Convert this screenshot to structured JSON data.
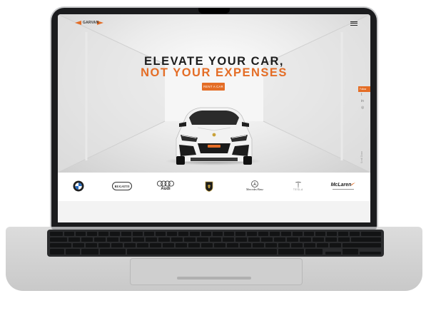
{
  "header": {
    "logo_text": "GARVAN",
    "menu_icon": "hamburger-menu-icon"
  },
  "hero": {
    "headline_line1": "ELEVATE YOUR CAR,",
    "headline_line2": "NOT YOUR EXPENSES",
    "cta_label": "RENT A CAR",
    "scroll_label": "Scroll Down",
    "accent_color": "#e46d26"
  },
  "social": {
    "follow_label": "Follow",
    "items": [
      {
        "name": "twitter-icon",
        "glyph": "t"
      },
      {
        "name": "linkedin-icon",
        "glyph": "in"
      },
      {
        "name": "instagram-icon",
        "glyph": "◎"
      }
    ]
  },
  "brands": [
    {
      "name": "BMW",
      "icon": "bmw-logo-icon"
    },
    {
      "name": "BUGATTI",
      "icon": "bugatti-logo-icon"
    },
    {
      "name": "Audi",
      "icon": "audi-logo-icon"
    },
    {
      "name": "Lamborghini",
      "icon": "lamborghini-logo-icon"
    },
    {
      "name": "Mercedes-Benz",
      "icon": "mercedes-logo-icon"
    },
    {
      "name": "TESLA",
      "icon": "tesla-logo-icon"
    },
    {
      "name": "McLaren",
      "icon": "mclaren-logo-icon"
    }
  ]
}
